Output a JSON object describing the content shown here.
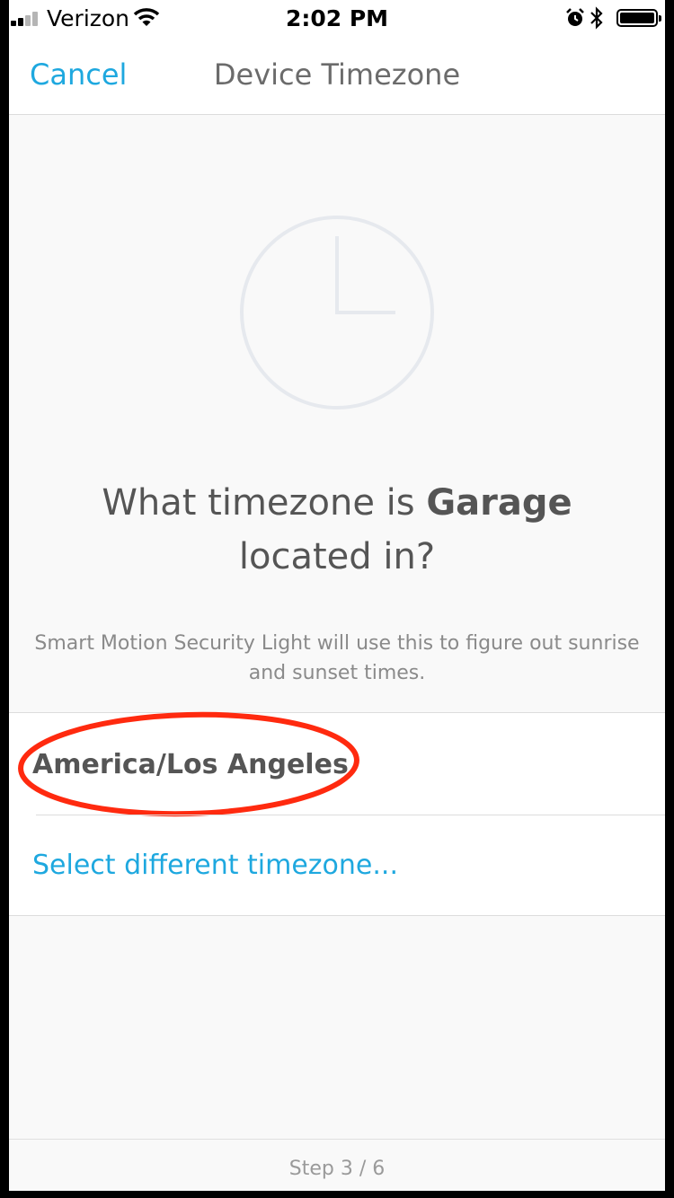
{
  "status_bar": {
    "carrier": "Verizon",
    "time": "2:02 PM",
    "icons": [
      "signal-icon",
      "wifi-icon",
      "alarm-icon",
      "bluetooth-icon",
      "battery-icon"
    ]
  },
  "nav": {
    "cancel_label": "Cancel",
    "title": "Device Timezone"
  },
  "content": {
    "icon": "clock-icon",
    "question_prefix": "What timezone is ",
    "device_name": "Garage",
    "question_suffix": "located in?",
    "description": "Smart Motion Security Light will use this to figure out sunrise and sunset times."
  },
  "timezone": {
    "current": "America/Los Angeles",
    "select_label": "Select different timezone..."
  },
  "footer": {
    "step_label": "Step 3 / 6"
  },
  "colors": {
    "accent": "#1ea8df",
    "annotation": "#ff2a0f",
    "text": "#555555",
    "muted": "#8a8a8a"
  }
}
